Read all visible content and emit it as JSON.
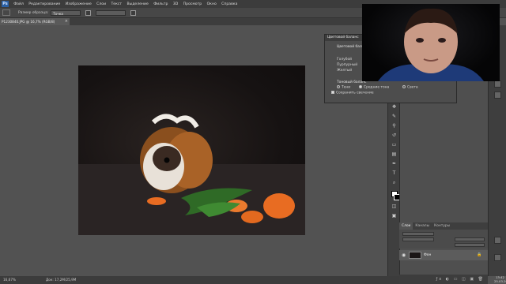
{
  "app": {
    "logo": "Ps"
  },
  "menu": [
    "Файл",
    "Редактирование",
    "Изображение",
    "Слои",
    "Текст",
    "Выделение",
    "Фильтр",
    "3D",
    "Просмотр",
    "Окно",
    "Справка"
  ],
  "options": {
    "sample_label": "Размер образца:",
    "sample_value": "Точка",
    "sample_all_label": "",
    "show_ring_label": ""
  },
  "document": {
    "tab_title": "P1230840.JPG @ 16,7% (RGB/8)",
    "close": "×"
  },
  "dialog": {
    "title": "Цветовой баланс",
    "section_title": "Цветовой баланс",
    "rows": [
      {
        "left": "",
        "right_color": "#c44444"
      },
      {
        "left": "Голубой",
        "right_color": "#44aa44"
      },
      {
        "left": "Пурпурный",
        "right_color": "#4466cc"
      },
      {
        "left": "Желтый",
        "right_color": "#cccccc"
      }
    ],
    "tone_title": "Тоновый баланс",
    "tone_options": [
      {
        "label": "Тени",
        "selected": false
      },
      {
        "label": "Средние тона",
        "selected": true
      },
      {
        "label": "Света",
        "selected": false
      }
    ],
    "preserve_label": "Сохранить свечение"
  },
  "layers_panel": {
    "tabs": [
      {
        "label": "Слои",
        "active": true
      },
      {
        "label": "Каналы",
        "active": false
      },
      {
        "label": "Контуры",
        "active": false
      }
    ],
    "layer": {
      "name": "Фон",
      "lock_icon": "🔒"
    },
    "footer_icons": "ƒx ◐ ▭ ◫ ▣ 🗑"
  },
  "status": {
    "zoom": "16,67%",
    "doc_info": "Док: 17,2M/25,9M"
  },
  "clock": {
    "time": "13:42",
    "date": "25.03.2019"
  },
  "colors": {
    "menubar": "#3c3c3c",
    "workspace": "#535353",
    "panel": "#4f4f4f",
    "photo_bg": "#161212",
    "carrot": "#e86c22",
    "parsley": "#2f6a26",
    "fur_brown": "#9a5a22"
  }
}
